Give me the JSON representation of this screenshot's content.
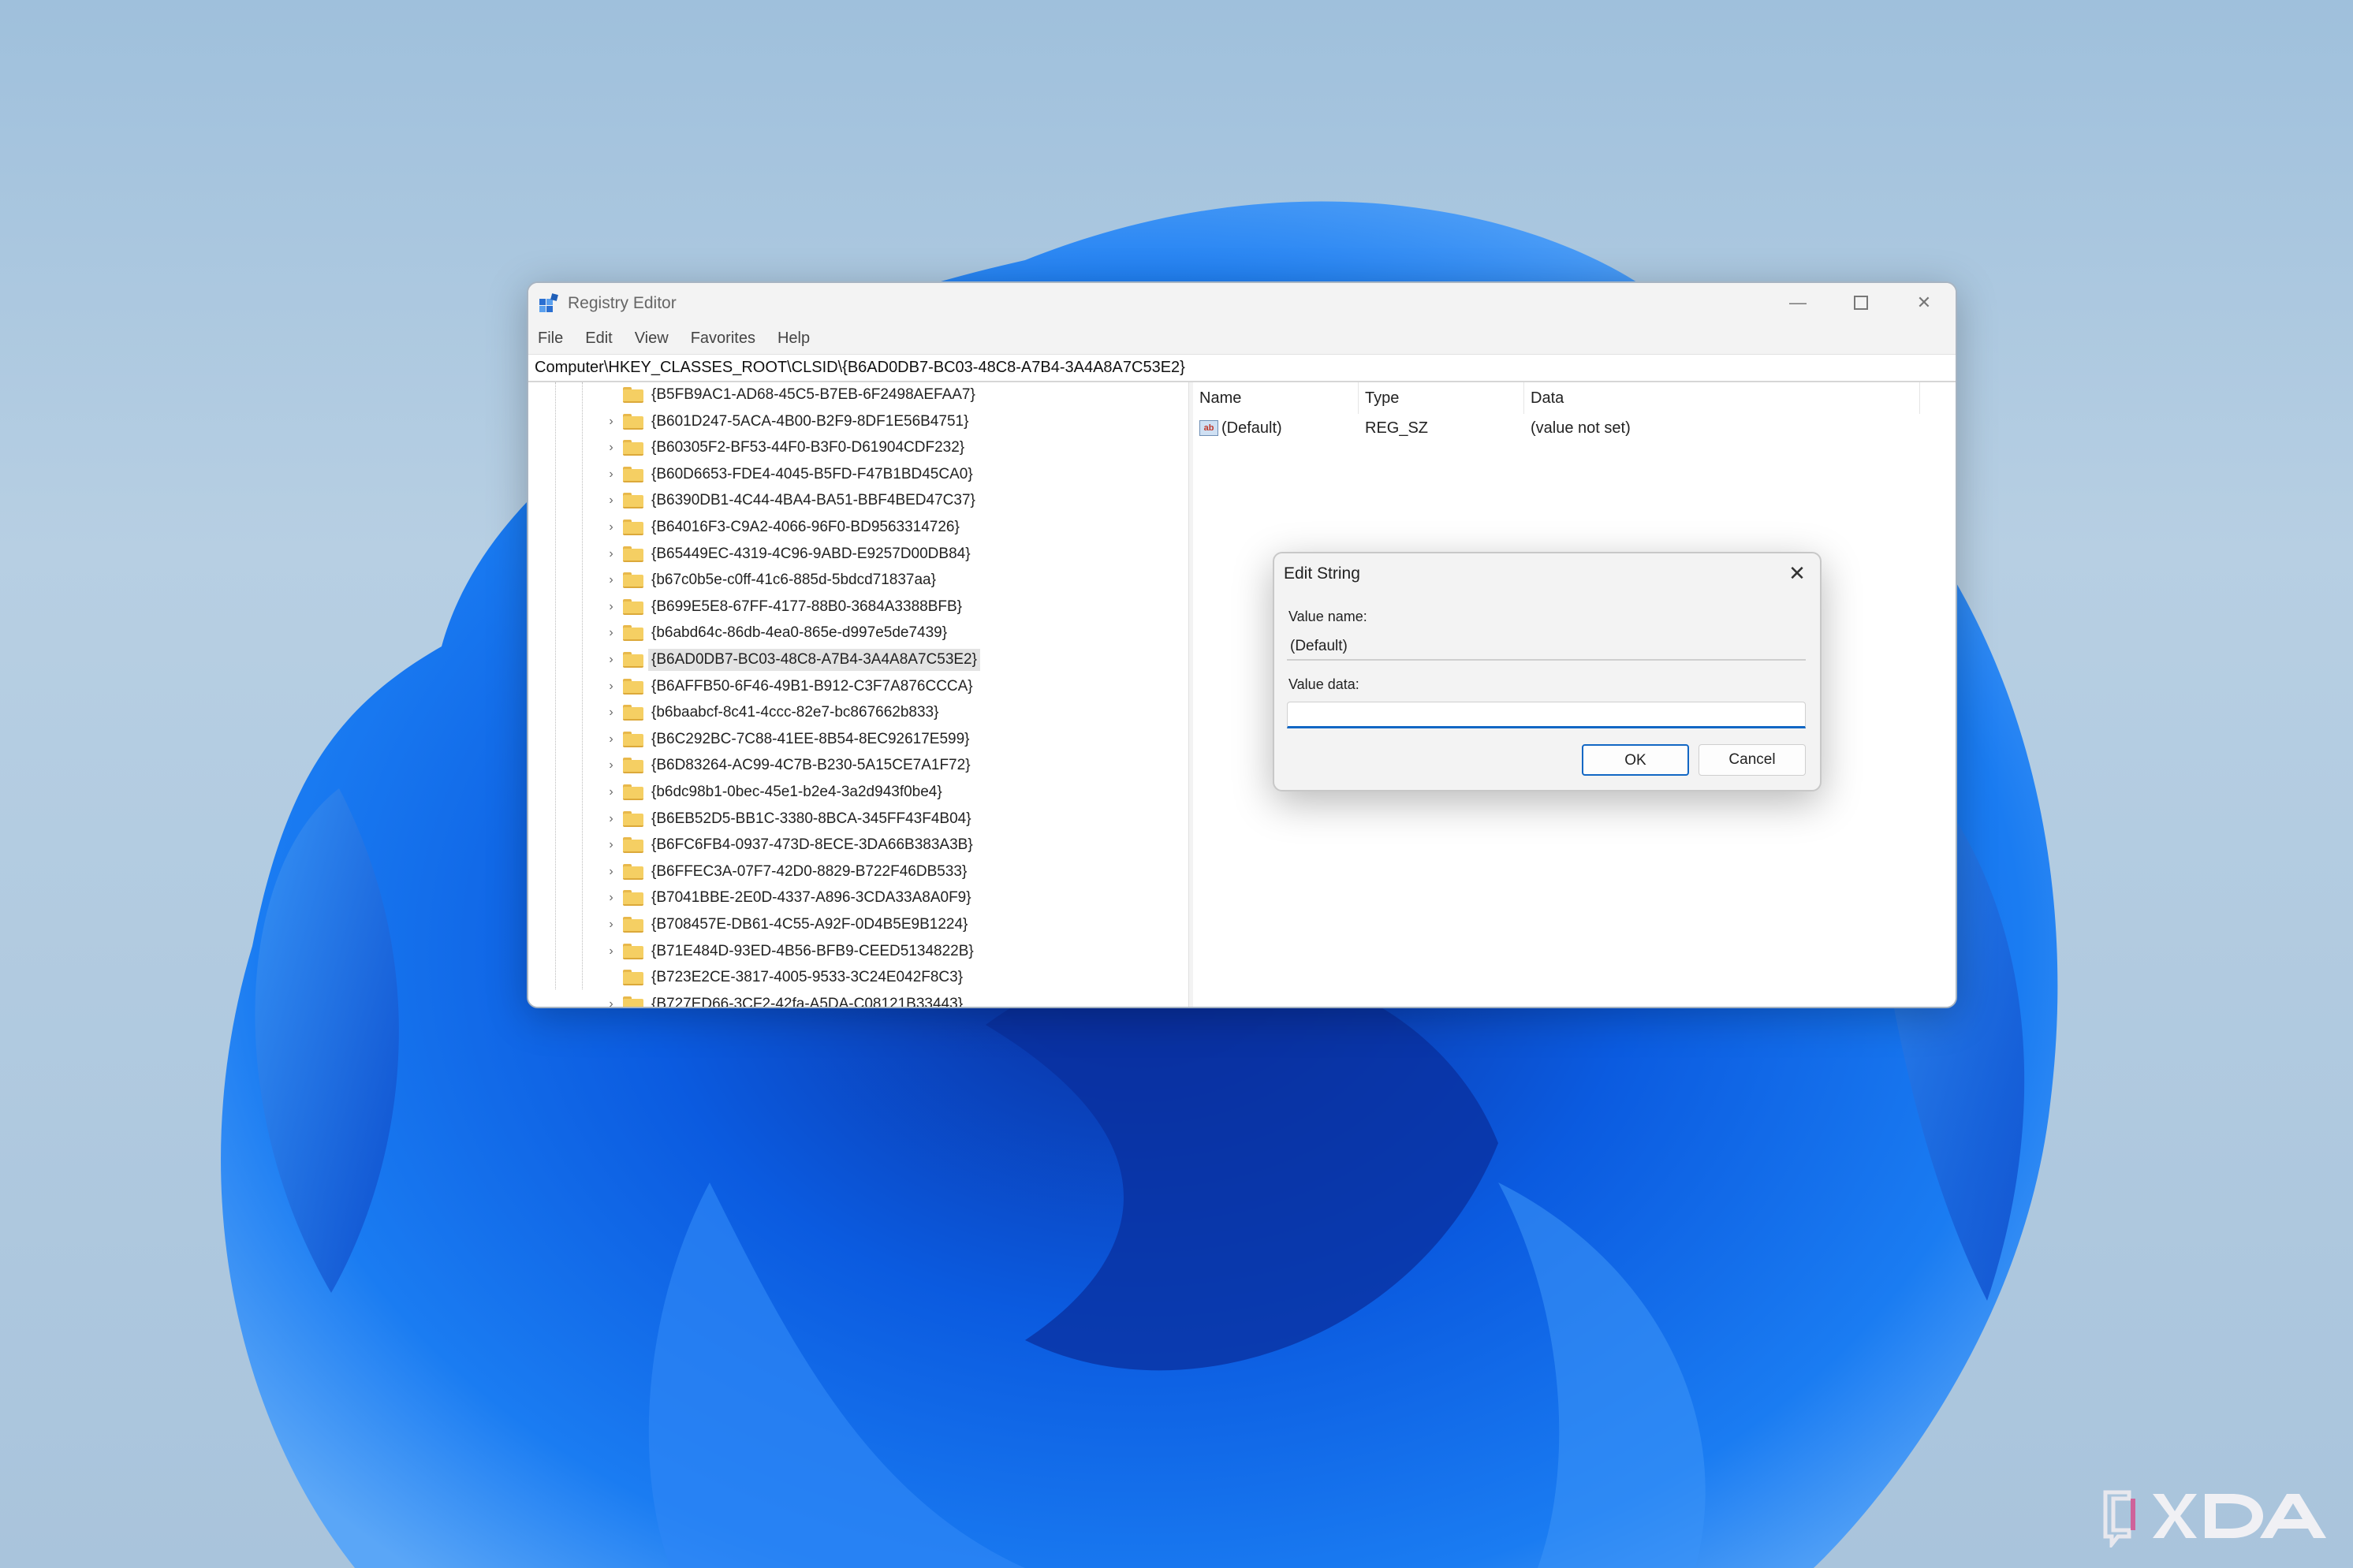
{
  "window": {
    "title": "Registry Editor",
    "minimize_glyph": "—",
    "close_glyph": "✕"
  },
  "menu": [
    "File",
    "Edit",
    "View",
    "Favorites",
    "Help"
  ],
  "address": "Computer\\HKEY_CLASSES_ROOT\\CLSID\\{B6AD0DB7-BC03-48C8-A7B4-3A4A8A7C53E2}",
  "tree": {
    "expander_glyph": "›",
    "items": [
      {
        "label": "{B5FB9AC1-AD68-45C5-B7EB-6F2498AEFAA7}",
        "expandable": false
      },
      {
        "label": "{B601D247-5ACA-4B00-B2F9-8DF1E56B4751}",
        "expandable": true
      },
      {
        "label": "{B60305F2-BF53-44F0-B3F0-D61904CDF232}",
        "expandable": true
      },
      {
        "label": "{B60D6653-FDE4-4045-B5FD-F47B1BD45CA0}",
        "expandable": true
      },
      {
        "label": "{B6390DB1-4C44-4BA4-BA51-BBF4BED47C37}",
        "expandable": true
      },
      {
        "label": "{B64016F3-C9A2-4066-96F0-BD9563314726}",
        "expandable": true
      },
      {
        "label": "{B65449EC-4319-4C96-9ABD-E9257D00DB84}",
        "expandable": true
      },
      {
        "label": "{b67c0b5e-c0ff-41c6-885d-5bdcd71837aa}",
        "expandable": true
      },
      {
        "label": "{B699E5E8-67FF-4177-88B0-3684A3388BFB}",
        "expandable": true
      },
      {
        "label": "{b6abd64c-86db-4ea0-865e-d997e5de7439}",
        "expandable": true
      },
      {
        "label": "{B6AD0DB7-BC03-48C8-A7B4-3A4A8A7C53E2}",
        "expandable": true,
        "selected": true
      },
      {
        "label": "{B6AFFB50-6F46-49B1-B912-C3F7A876CCCA}",
        "expandable": true
      },
      {
        "label": "{b6baabcf-8c41-4ccc-82e7-bc867662b833}",
        "expandable": true
      },
      {
        "label": "{B6C292BC-7C88-41EE-8B54-8EC92617E599}",
        "expandable": true
      },
      {
        "label": "{B6D83264-AC99-4C7B-B230-5A15CE7A1F72}",
        "expandable": true
      },
      {
        "label": "{b6dc98b1-0bec-45e1-b2e4-3a2d943f0be4}",
        "expandable": true
      },
      {
        "label": "{B6EB52D5-BB1C-3380-8BCA-345FF43F4B04}",
        "expandable": true
      },
      {
        "label": "{B6FC6FB4-0937-473D-8ECE-3DA66B383A3B}",
        "expandable": true
      },
      {
        "label": "{B6FFEC3A-07F7-42D0-8829-B722F46DB533}",
        "expandable": true
      },
      {
        "label": "{B7041BBE-2E0D-4337-A896-3CDA33A8A0F9}",
        "expandable": true
      },
      {
        "label": "{B708457E-DB61-4C55-A92F-0D4B5E9B1224}",
        "expandable": true
      },
      {
        "label": "{B71E484D-93ED-4B56-BFB9-CEED5134822B}",
        "expandable": true
      },
      {
        "label": "{B723E2CE-3817-4005-9533-3C24E042F8C3}",
        "expandable": false
      },
      {
        "label": "{B727ED66-3CF2-42fa-A5DA-C08121B33443}",
        "expandable": true
      }
    ]
  },
  "values": {
    "columns": [
      "Name",
      "Type",
      "Data"
    ],
    "rows": [
      {
        "icon": "string-value-icon",
        "icon_text": "ab",
        "name": "(Default)",
        "type": "REG_SZ",
        "data": "(value not set)"
      }
    ]
  },
  "dialog": {
    "title": "Edit String",
    "close_glyph": "✕",
    "value_name_label": "Value name:",
    "value_name": "(Default)",
    "value_data_label": "Value data:",
    "value_data": "",
    "ok_label": "OK",
    "cancel_label": "Cancel"
  },
  "colors": {
    "accent": "#1267c4",
    "folder": "#f5cf63",
    "wallpaper_blue": "#0a5fe0"
  }
}
